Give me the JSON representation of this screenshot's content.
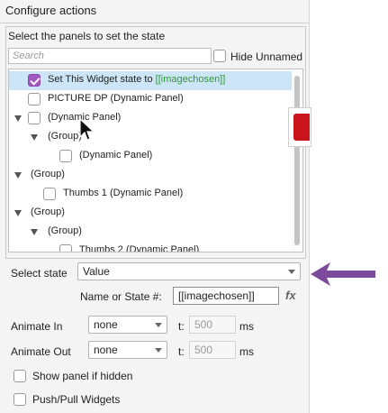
{
  "dialog": {
    "title": "Configure actions"
  },
  "panels": {
    "heading": "Select the panels to set the state",
    "search_placeholder": "Search",
    "hide_unnamed_label": "Hide Unnamed",
    "hide_unnamed_checked": false,
    "tree": [
      {
        "label_prefix": "Set This Widget state to ",
        "label_var": "[[imagechosen]]",
        "checked": true,
        "selected": true,
        "expandable": false
      },
      {
        "label": "PICTURE DP (Dynamic Panel)",
        "checked": false
      },
      {
        "label": "(Dynamic Panel)",
        "checked": false,
        "expandable": true
      },
      {
        "label": "(Group)",
        "expandable": true
      },
      {
        "label": "(Dynamic Panel)",
        "checked": false
      },
      {
        "label": "(Group)",
        "expandable": true
      },
      {
        "label": "Thumbs 1 (Dynamic Panel)",
        "checked": false
      },
      {
        "label": "(Group)",
        "expandable": true
      },
      {
        "label": "(Group)",
        "expandable": true
      },
      {
        "label": "Thumbs 2 (Dynamic Panel)",
        "checked": false
      }
    ]
  },
  "state": {
    "select_label": "Select state",
    "select_value": "Value",
    "name_label": "Name or State #:",
    "name_value": "[[imagechosen]]",
    "fx_label": "fx"
  },
  "animate_in": {
    "label": "Animate In",
    "value": "none",
    "t_label": "t:",
    "duration": "500",
    "unit": "ms"
  },
  "animate_out": {
    "label": "Animate Out",
    "value": "none",
    "t_label": "t:",
    "duration": "500",
    "unit": "ms"
  },
  "options": {
    "show_if_hidden": "Show panel if hidden",
    "push_pull": "Push/Pull Widgets"
  },
  "colors": {
    "accent": "#a257c1",
    "highlight_arrow": "#7b4a9b",
    "variable_text": "#2f9a2f"
  },
  "icons": {
    "pointer": "mouse-pointer-icon",
    "annotation": "arrow-left-icon",
    "popup": "red-swatch"
  }
}
